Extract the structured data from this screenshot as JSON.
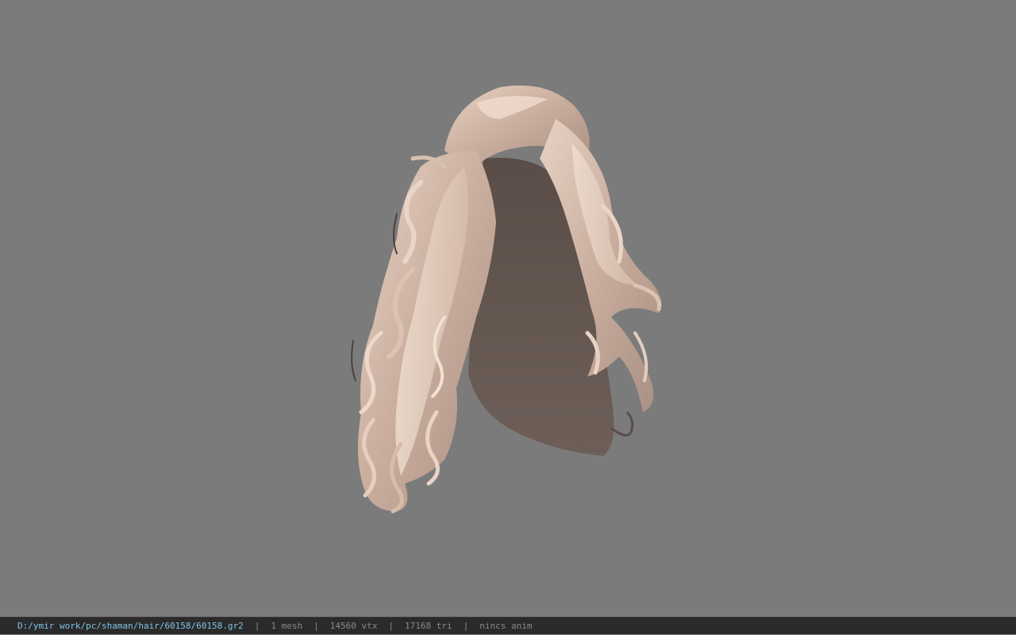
{
  "viewport": {
    "background": "#7b7b7b",
    "model_icon": "hair-mesh-render"
  },
  "statusbar": {
    "file_path": "D:/ymir work/pc/shaman/hair/60158/60158.gr2",
    "mesh_count": "1 mesh",
    "vertex_count": "14560 vtx",
    "triangle_count": "17168 tri",
    "anim_status": "nincs anim",
    "separator": "|",
    "path_color": "#7fc4e8",
    "text_color": "#8a8a8a"
  }
}
